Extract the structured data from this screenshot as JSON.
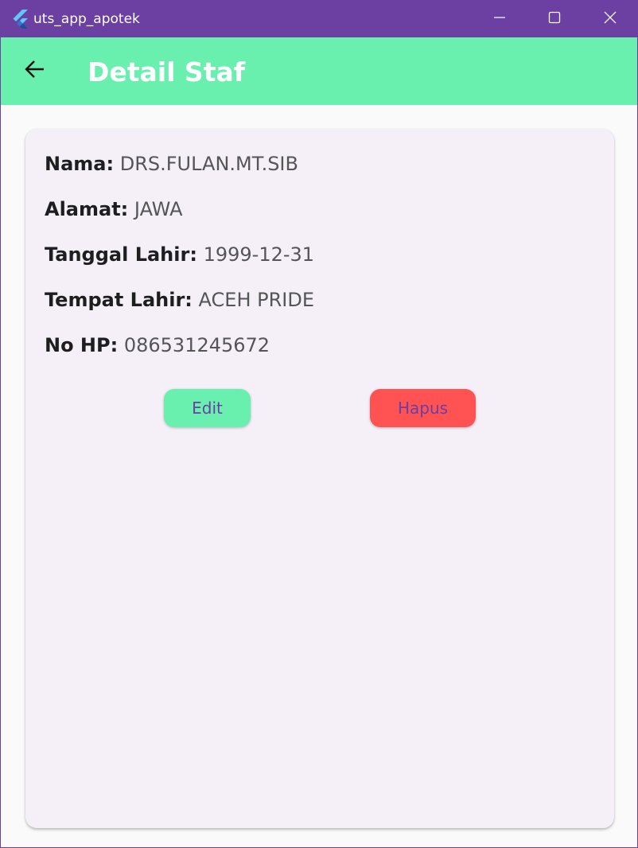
{
  "window": {
    "title": "uts_app_apotek",
    "controls": {
      "minimize_icon": "minimize-icon",
      "maximize_icon": "maximize-icon",
      "close_icon": "close-icon"
    },
    "titlebar_color": "#6c3fa3"
  },
  "appbar": {
    "title": "Detail Staf",
    "back_icon": "arrow-left-icon",
    "color": "#69f0ae"
  },
  "staff": {
    "fields": [
      {
        "label": "Nama:",
        "value": "DRS.FULAN.MT.SIB"
      },
      {
        "label": "Alamat:",
        "value": "JAWA"
      },
      {
        "label": "Tanggal Lahir:",
        "value": "1999-12-31"
      },
      {
        "label": "Tempat Lahir:",
        "value": "ACEH PRIDE"
      },
      {
        "label": "No HP:",
        "value": "086531245672"
      }
    ]
  },
  "actions": {
    "edit_label": "Edit",
    "delete_label": "Hapus",
    "edit_color": "#69f0ae",
    "delete_color": "#ff5252"
  }
}
